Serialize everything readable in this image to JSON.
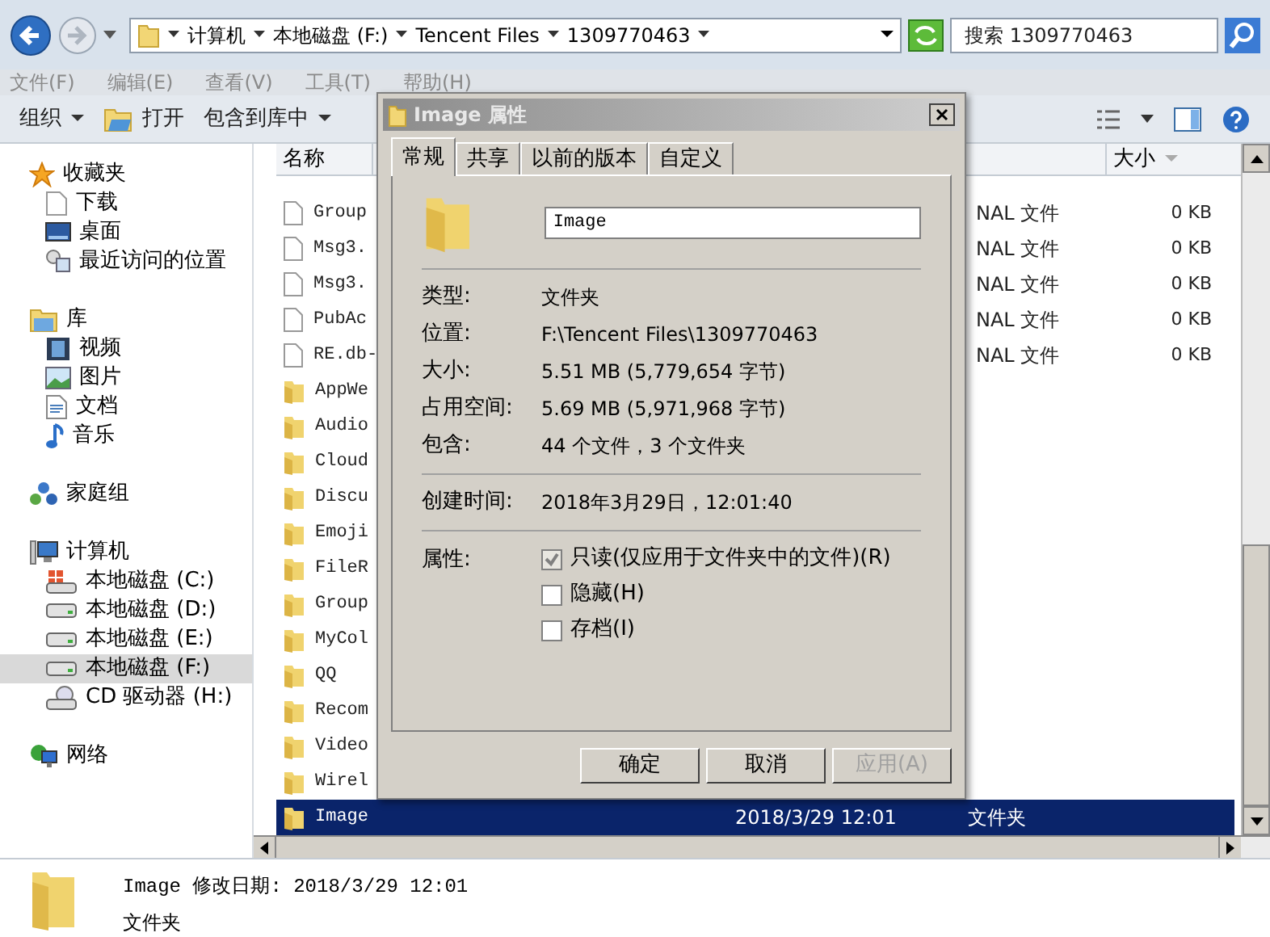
{
  "address_bar": {
    "breadcrumbs": [
      "计算机",
      "本地磁盘 (F:)",
      "Tencent Files",
      "1309770463"
    ],
    "search_placeholder": "搜索 1309770463"
  },
  "menu_bar": [
    {
      "label": "文件(F)",
      "disabled": true
    },
    {
      "label": "编辑(E)",
      "disabled": true
    },
    {
      "label": "查看(V)",
      "disabled": true
    },
    {
      "label": "工具(T)",
      "disabled": true
    },
    {
      "label": "帮助(H)",
      "disabled": true
    }
  ],
  "toolbar": [
    {
      "label": "组织",
      "kind": "dropdown"
    },
    {
      "label": "打开",
      "kind": "open"
    },
    {
      "label": "包含到库中",
      "kind": "dropdown"
    }
  ],
  "sidebar": {
    "items": [
      {
        "label": "收藏夹",
        "kind": "star",
        "selected": false,
        "children": [
          {
            "label": "下载",
            "kind": "page",
            "selected": false
          },
          {
            "label": "桌面",
            "kind": "desktop",
            "selected": false
          },
          {
            "label": "最近访问的位置",
            "kind": "recent",
            "selected": false
          }
        ]
      },
      {
        "label": "库",
        "kind": "library",
        "selected": false,
        "children": [
          {
            "label": "视频",
            "kind": "video",
            "selected": false
          },
          {
            "label": "图片",
            "kind": "image",
            "selected": false
          },
          {
            "label": "文档",
            "kind": "doc",
            "selected": false
          },
          {
            "label": "音乐",
            "kind": "music",
            "selected": false
          }
        ]
      },
      {
        "label": "家庭组",
        "kind": "homegroup",
        "selected": false
      },
      {
        "label": "计算机",
        "kind": "computer",
        "selected": false,
        "children": [
          {
            "label": "本地磁盘 (C:)",
            "kind": "sysdrive",
            "selected": false
          },
          {
            "label": "本地磁盘 (D:)",
            "kind": "drive",
            "selected": false
          },
          {
            "label": "本地磁盘 (E:)",
            "kind": "drive",
            "selected": false
          },
          {
            "label": "本地磁盘 (F:)",
            "kind": "drive",
            "selected": true
          },
          {
            "label": "CD 驱动器 (H:)",
            "kind": "cd",
            "selected": false
          }
        ]
      },
      {
        "label": "网络",
        "kind": "network",
        "selected": false
      }
    ]
  },
  "file_list": {
    "columns": [
      "名称",
      "大小"
    ],
    "rows": [
      {
        "name": "Group",
        "kind": "file",
        "type": "NAL 文件",
        "size": "0 KB",
        "selected": false
      },
      {
        "name": "Msg3.",
        "kind": "file",
        "type": "NAL 文件",
        "size": "0 KB",
        "selected": false
      },
      {
        "name": "Msg3.",
        "kind": "file",
        "type": "NAL 文件",
        "size": "0 KB",
        "selected": false
      },
      {
        "name": "PubAc",
        "kind": "file",
        "type": "NAL 文件",
        "size": "0 KB",
        "selected": false
      },
      {
        "name": "RE.db-",
        "kind": "file",
        "type": "NAL 文件",
        "size": "0 KB",
        "selected": false
      },
      {
        "name": "AppWe",
        "kind": "folder",
        "selected": false
      },
      {
        "name": "Audio",
        "kind": "folder",
        "selected": false
      },
      {
        "name": "Cloud",
        "kind": "folder",
        "selected": false
      },
      {
        "name": "Discu",
        "kind": "folder",
        "selected": false
      },
      {
        "name": "Emoji",
        "kind": "folder",
        "selected": false
      },
      {
        "name": "FileR",
        "kind": "folder",
        "selected": false
      },
      {
        "name": "Group",
        "kind": "folder",
        "selected": false
      },
      {
        "name": "MyCol",
        "kind": "folder",
        "selected": false
      },
      {
        "name": "QQ",
        "kind": "folder",
        "selected": false
      },
      {
        "name": "Recom",
        "kind": "folder",
        "selected": false
      },
      {
        "name": "Video",
        "kind": "folder",
        "selected": false
      },
      {
        "name": "Wirel",
        "kind": "folder",
        "selected": false
      },
      {
        "name": "Image",
        "kind": "folder",
        "date": "2018/3/29 12:01",
        "type": "文件夹",
        "selected": true
      }
    ]
  },
  "details_pane": {
    "title": "Image 修改日期: 2018/3/29 12:01",
    "subtitle": "文件夹"
  },
  "dialog": {
    "title": "Image 属性",
    "tabs": [
      {
        "label": "常规",
        "selected": true
      },
      {
        "label": "共享",
        "selected": false
      },
      {
        "label": "以前的版本",
        "selected": false
      },
      {
        "label": "自定义",
        "selected": false
      }
    ],
    "name_value": "Image",
    "sections": [
      [
        {
          "label": "类型:",
          "value": "文件夹"
        },
        {
          "label": "位置:",
          "value": "F:\\Tencent Files\\1309770463"
        },
        {
          "label": "大小:",
          "value": "5.51 MB (5,779,654 字节)"
        },
        {
          "label": "占用空间:",
          "value": "5.69 MB (5,971,968 字节)"
        },
        {
          "label": "包含:",
          "value": "44 个文件，3 个文件夹"
        }
      ],
      [
        {
          "label": "创建时间:",
          "value": "2018年3月29日，12:01:40"
        }
      ]
    ],
    "attributes_label": "属性:",
    "attributes": [
      {
        "label": "只读(仅应用于文件夹中的文件)(R)",
        "checked": true,
        "disabled": true
      },
      {
        "label": "隐藏(H)",
        "checked": false,
        "disabled": false
      },
      {
        "label": "存档(I)",
        "checked": false,
        "disabled": false
      }
    ],
    "buttons": [
      {
        "label": "确定",
        "disabled": false
      },
      {
        "label": "取消",
        "disabled": false
      },
      {
        "label": "应用(A)",
        "disabled": true
      }
    ]
  }
}
